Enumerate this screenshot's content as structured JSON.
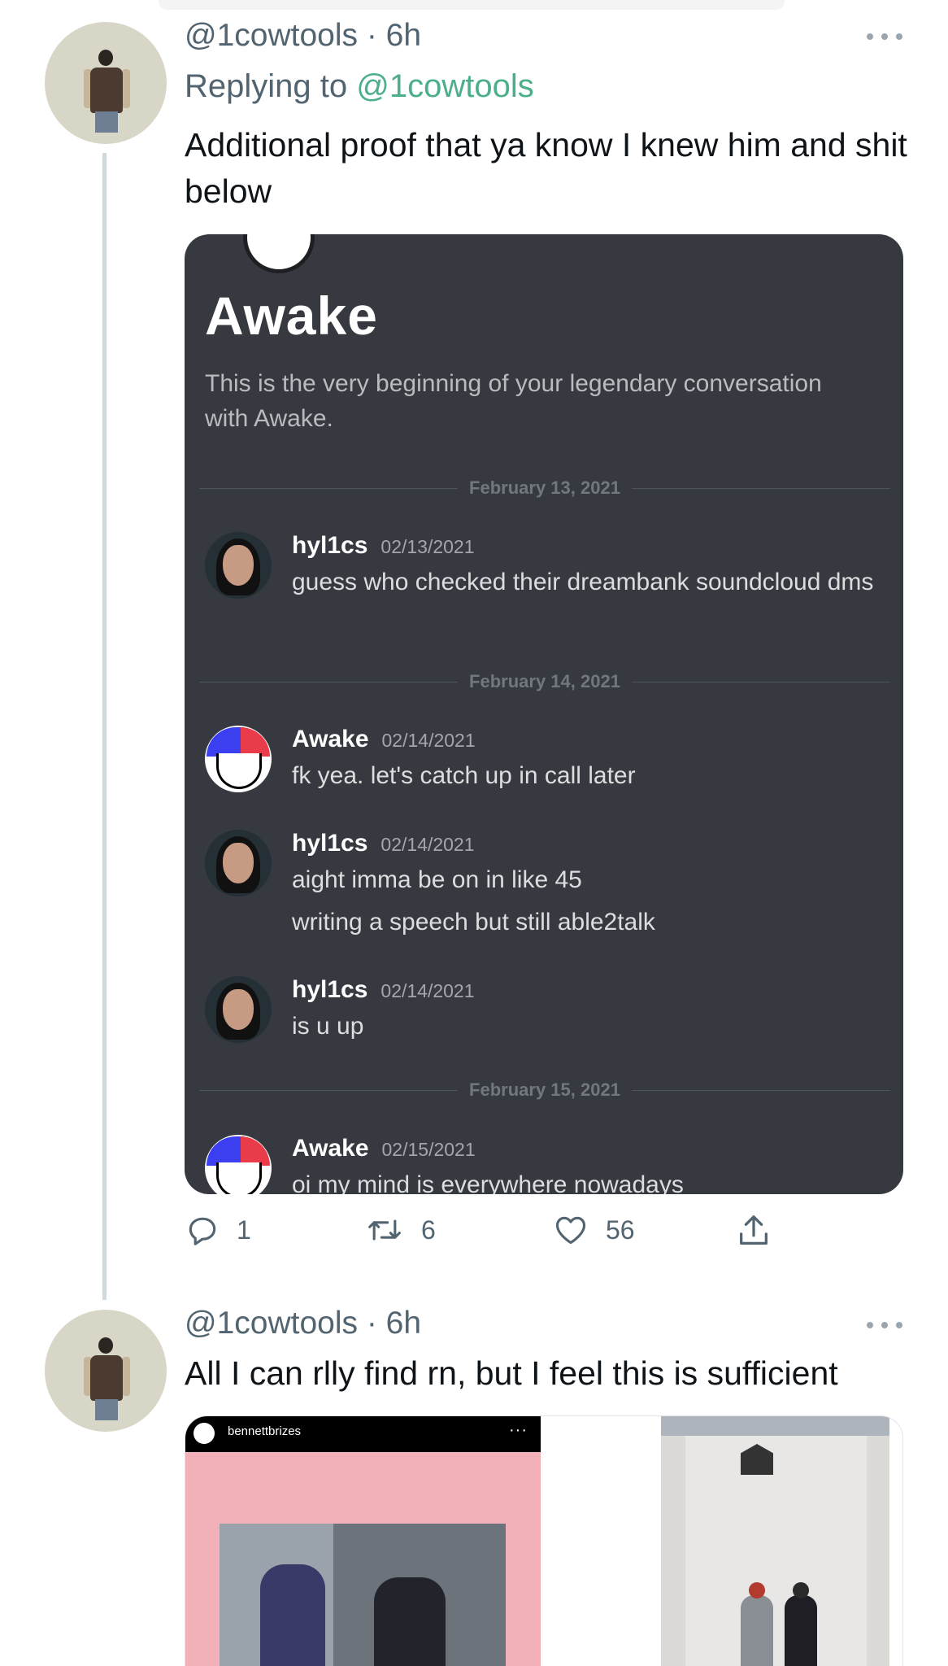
{
  "tweets": [
    {
      "handle_time": "@1cowtools · 6h",
      "replying_prefix": "Replying to ",
      "replying_handle": "@1cowtools",
      "text": "Additional proof that ya know I knew him and shit below",
      "attachment": {
        "conversation_title": "Awake",
        "conversation_intro": "This is the very beginning of your legendary conversation with Awake.",
        "dividers": [
          "February 13, 2021",
          "February 14, 2021",
          "February 15, 2021"
        ],
        "messages": [
          {
            "author": "hyl1cs",
            "date": "02/13/2021",
            "lines": [
              "guess who checked their dreambank soundcloud dms"
            ]
          },
          {
            "author": "Awake",
            "date": "02/14/2021",
            "lines": [
              "fk yea. let's catch up in call later"
            ]
          },
          {
            "author": "hyl1cs",
            "date": "02/14/2021",
            "lines": [
              "aight imma be on in like 45",
              "writing a speech but still able2talk"
            ]
          },
          {
            "author": "hyl1cs",
            "date": "02/14/2021",
            "lines": [
              "is u up"
            ]
          },
          {
            "author": "Awake",
            "date": "02/15/2021",
            "lines": [
              "oi my mind is everywhere nowadays"
            ]
          }
        ]
      },
      "actions": {
        "replies": "1",
        "retweets": "6",
        "likes": "56"
      }
    },
    {
      "handle_time": "@1cowtools · 6h",
      "text": "All I can rlly find rn, but I feel this is sufficient",
      "media": {
        "instagram_user": "bennettbrizes",
        "instagram_menu": "···"
      }
    }
  ],
  "icons": [
    "avatar",
    "more-icon",
    "reply-icon",
    "retweet-icon",
    "like-icon",
    "share-icon"
  ],
  "colors": {
    "accent": "#4caf8a",
    "discord_bg": "#36393f",
    "muted": "#536471"
  }
}
